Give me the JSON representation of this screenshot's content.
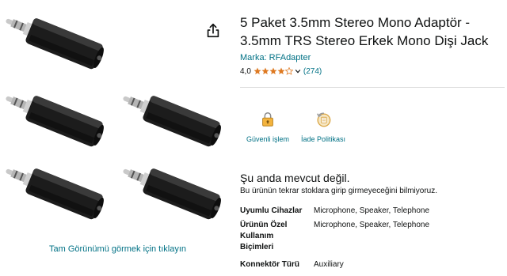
{
  "product": {
    "title": "5 Paket 3.5mm Stereo Mono Adaptör - 3.5mm TRS Stereo Erkek Mono Dişi Jack",
    "brand": "Marka: RFAdapter",
    "rating_value": "4,0",
    "rating_stars": 4,
    "rating_count": "(274)"
  },
  "gallery": {
    "zoom_link": "Tam Görünümü görmek için tıklayın",
    "share_icon": "share-icon"
  },
  "features": [
    {
      "label": "Güvenli işlem",
      "icon": "secure-transaction-icon"
    },
    {
      "label": "İade Politikası",
      "icon": "return-policy-icon"
    }
  ],
  "availability": {
    "status": "Şu anda mevcut değil.",
    "note": "Bu ürünün tekrar stoklara girip girmeyeceğini bilmiyoruz."
  },
  "specs": [
    {
      "key": "Uyumlu Cihazlar",
      "value": "Microphone, Speaker, Telephone"
    },
    {
      "key": "Ürünün Özel Kullanım Biçimleri",
      "value": "Microphone, Speaker, Telephone"
    },
    {
      "key": "Konnektör Türü",
      "value": "Auxiliary"
    }
  ],
  "colors": {
    "link": "#007185",
    "star": "#de7921",
    "text": "#0f1111"
  }
}
